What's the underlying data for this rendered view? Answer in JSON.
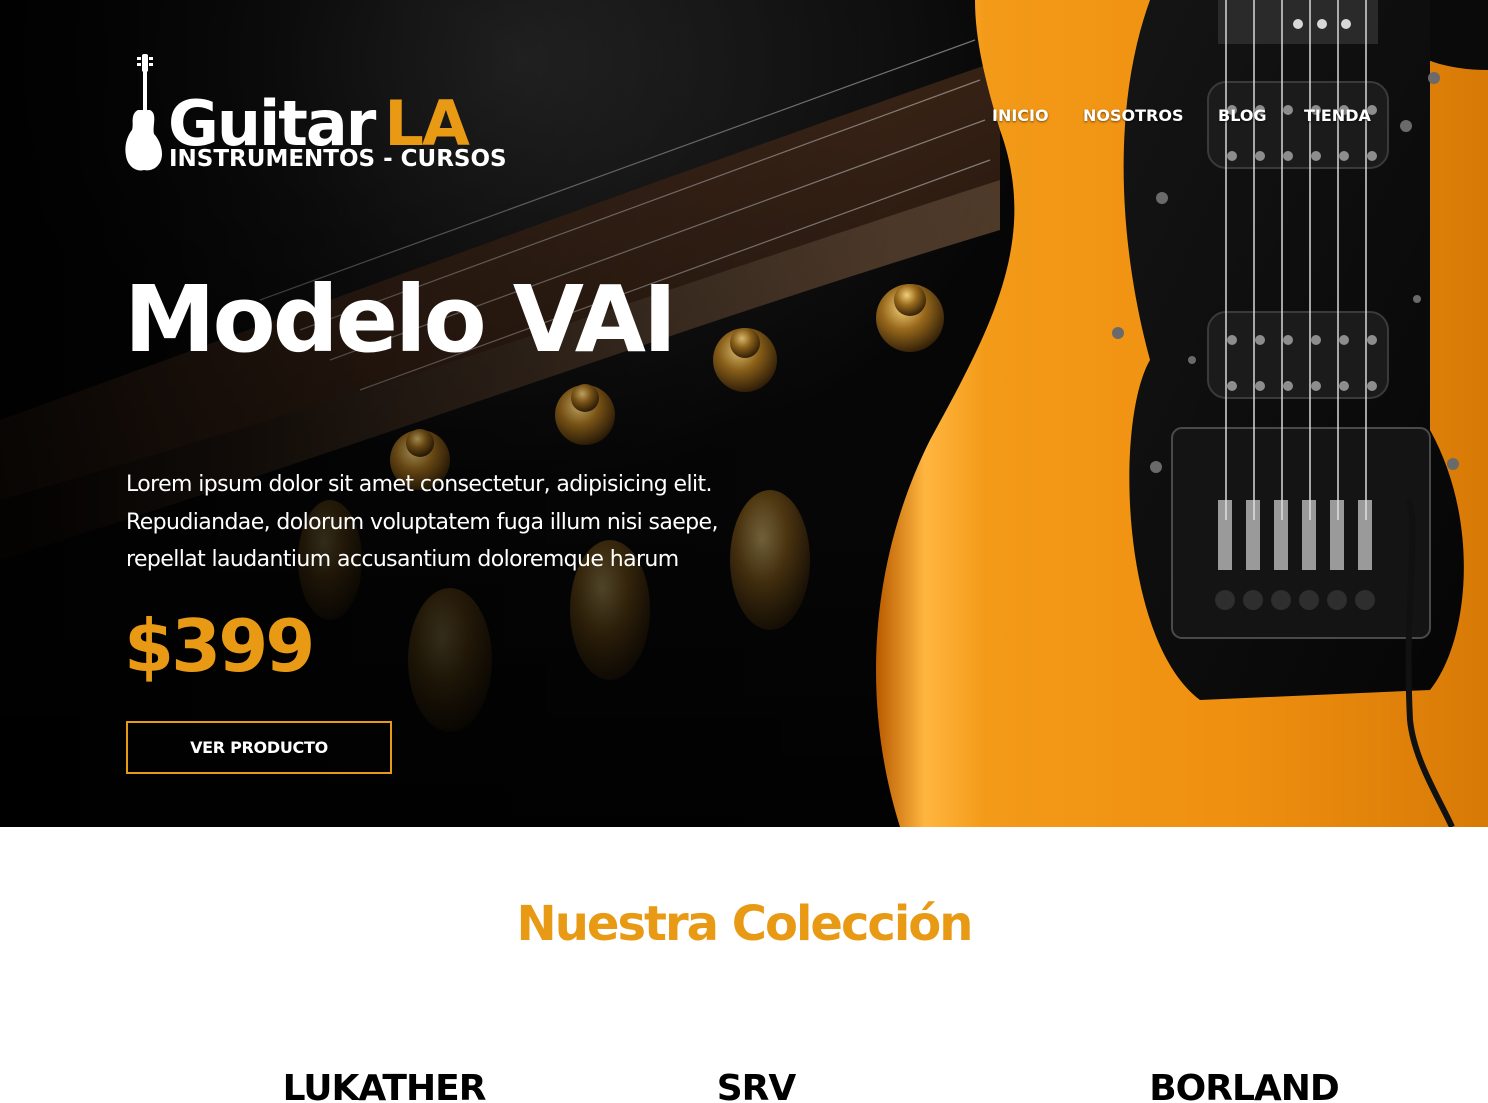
{
  "brand": {
    "name_main": "Guitar",
    "name_accent": "LA",
    "tagline": "INSTRUMENTOS - CURSOS",
    "logo_icon": "guitar-icon"
  },
  "nav": {
    "items": [
      {
        "label": "INICIO"
      },
      {
        "label": "NOSOTROS"
      },
      {
        "label": "BLOG"
      },
      {
        "label": "TIENDA"
      }
    ]
  },
  "hero": {
    "title": "Modelo VAI",
    "description": "Lorem ipsum dolor sit amet consectetur, adipisicing elit. Repudiandae, dolorum voluptatem fuga illum nisi saepe, repellat laudantium accusantium doloremque harum",
    "price": "$399",
    "button_label": "VER PRODUCTO"
  },
  "collection": {
    "title": "Nuestra Colección",
    "items": [
      {
        "name": "LUKATHER"
      },
      {
        "name": "SRV"
      },
      {
        "name": "BORLAND"
      }
    ]
  },
  "colors": {
    "accent": "#e99a15",
    "hero_background": "#0b0b0b",
    "text_light": "#ffffff",
    "text_dark": "#000000"
  }
}
